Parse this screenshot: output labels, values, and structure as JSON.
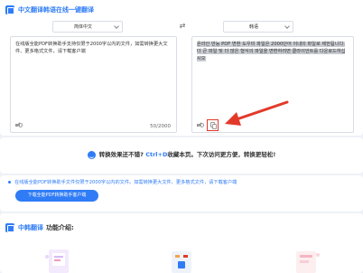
{
  "header": {
    "title": "中文翻译韩语在线一键翻译"
  },
  "languages": {
    "source": "简体中文",
    "target": "韩语",
    "swap_icon": "swap-arrows-icon"
  },
  "source_panel": {
    "text": "在线版全能PDF转换助手支持仅限于2000字以内的文件，如需转换更大文件、更多格式文件，请下载客户端",
    "counter": "50/2000"
  },
  "target_panel": {
    "text": "온라인 만능 PDF 변환 도우미 파일은 2000단어 이내의 파일로 제한됩니다. 더 큰 파일 및 더 많은 형식의 파일을 변환하려면 클라이언트를 다운로드하십시오"
  },
  "favorite": {
    "text_before": "转换效果还不错?",
    "hotkey": "Ctrl+D",
    "text_after": "收藏本页。下次访问更方便，转换更轻松!"
  },
  "promo": {
    "text": "在线版全能PDF转换助手文件仅限于2000字以内的文件。如需转换更大文件、更多格式文件，请下载客户端",
    "button": "下载全能PDF转换助手客户端"
  },
  "intro": {
    "title_accent": "中韩翻译",
    "title_rest": "功能介绍:"
  },
  "colors": {
    "accent": "#2f7cf6",
    "highlight_box": "#e3392a",
    "page_bg": "#eef1f6"
  }
}
